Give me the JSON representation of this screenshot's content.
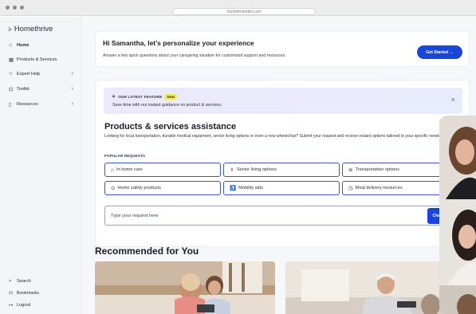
{
  "browser": {
    "url": "homethrivedev.com"
  },
  "sidebar": {
    "brand": "Homethrive",
    "items": [
      {
        "label": "Home",
        "icon": "home-icon"
      },
      {
        "label": "Products & Services",
        "icon": "grid-icon"
      },
      {
        "label": "Expert Help",
        "icon": "headset-icon"
      },
      {
        "label": "Toolkit",
        "icon": "toolkit-icon"
      },
      {
        "label": "Resources",
        "icon": "book-icon"
      }
    ],
    "bottom": [
      {
        "label": "Search",
        "icon": "search-icon"
      },
      {
        "label": "Bookmarks",
        "icon": "bookmark-icon"
      },
      {
        "label": "Logout",
        "icon": "logout-icon"
      }
    ]
  },
  "welcome": {
    "title": "Hi Samantha, let’s personalize your experience",
    "subtitle": "Answer a few quick questions about your caregiving situation for customized support and resources.",
    "button": "Get Started  →"
  },
  "feature": {
    "tag": "OUR LATEST FEATURE",
    "badge": "New",
    "text": "Save time with our instant guidance on product & services."
  },
  "assist": {
    "title": "Products & services assistance",
    "description": "Looking for local transportation, durable medical equipment, senior living options or even a new wheelchair? Submit your request and receive instant options tailored to your specific needs.",
    "popular_label": "POPULAR REQUESTS",
    "chips": [
      "In-home care",
      "Senior living options",
      "Transportation options",
      "Home safety products",
      "Mobility aids",
      "Meal delivery resources"
    ],
    "input_placeholder": "Type your request here",
    "chat_button": "Chat Now"
  },
  "recommended": {
    "title": "Recommended for You"
  },
  "colors": {
    "accent": "#1a46d8",
    "badge": "#f2ec3e",
    "banner": "#ebe9fb"
  }
}
